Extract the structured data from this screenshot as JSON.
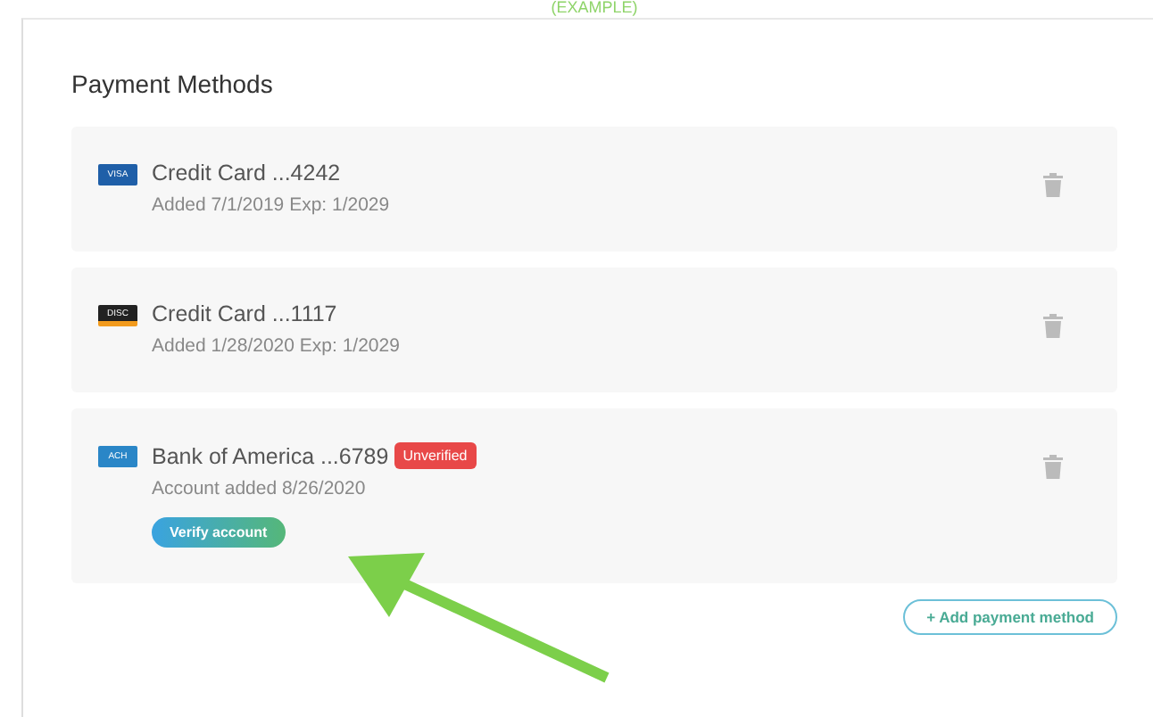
{
  "annotation": "(EXAMPLE)",
  "title": "Payment Methods",
  "methods": [
    {
      "kind": "visa",
      "icon_text": "VISA",
      "name": "Credit Card ...4242",
      "detail": "Added 7/1/2019 Exp: 1/2029"
    },
    {
      "kind": "card",
      "icon_text": "DISC",
      "name": "Credit Card ...1117",
      "detail": "Added 1/28/2020 Exp: 1/2029"
    },
    {
      "kind": "ach",
      "icon_text": "ACH",
      "name": "Bank of America ...6789",
      "badge": "Unverified",
      "detail": "Account added 8/26/2020",
      "action": "Verify account"
    }
  ],
  "add_button": "+ Add payment method"
}
